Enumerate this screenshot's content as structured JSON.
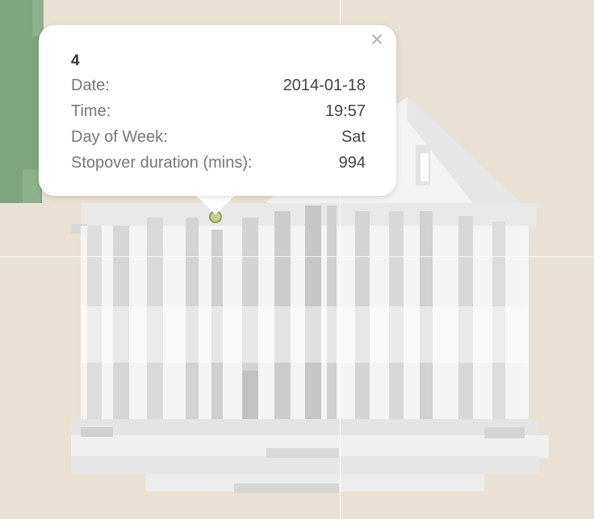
{
  "popup": {
    "title": "4",
    "rows": [
      {
        "label": "Date:",
        "value": "2014-01-18"
      },
      {
        "label": "Time:",
        "value": "19:57"
      },
      {
        "label": "Day of Week:",
        "value": "Sat"
      },
      {
        "label": "Stopover duration (mins):",
        "value": "994"
      }
    ],
    "close_icon": "close-icon"
  },
  "colors": {
    "background": "#e9e1d4",
    "park_green": "#7fa57f",
    "building_light": "#f4f4f4",
    "building_dark": "#cfcfcf",
    "marker": "#c8cf8a"
  }
}
